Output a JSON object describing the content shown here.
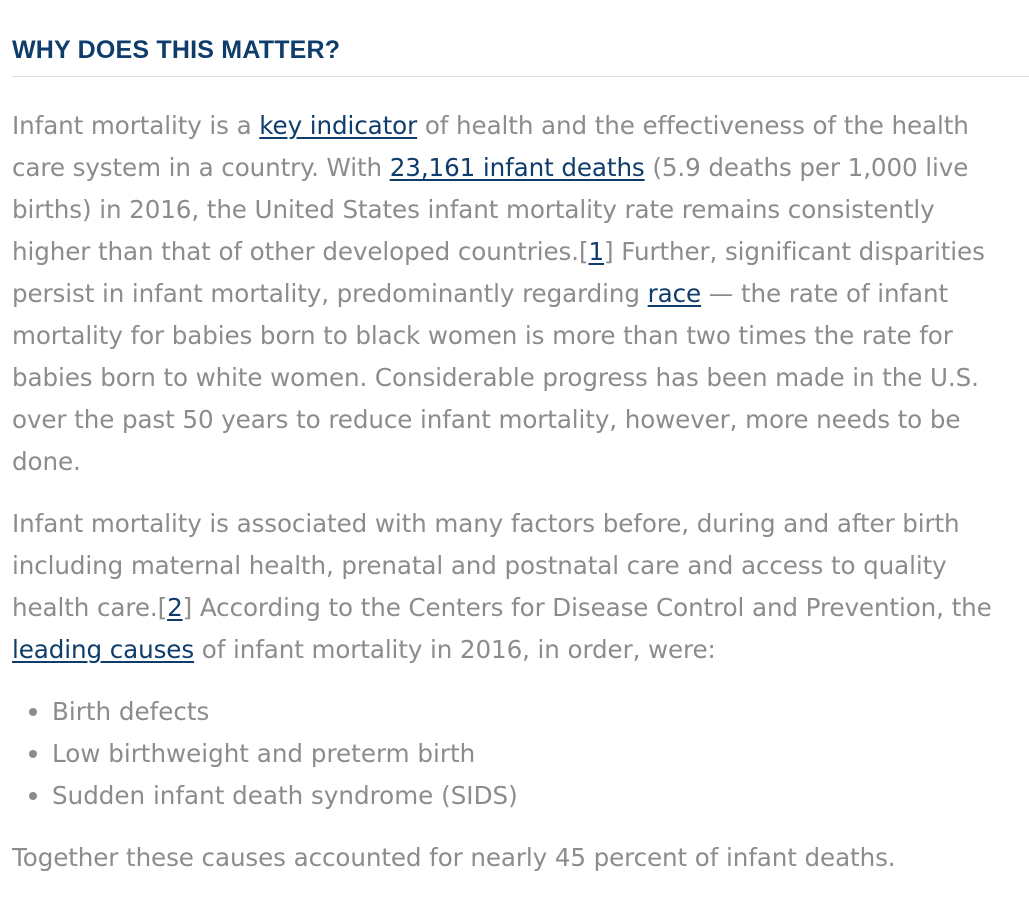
{
  "heading": "WHY DOES THIS MATTER?",
  "p1": {
    "t1": "Infant mortality is a ",
    "link1": "key indicator",
    "t2": " of health and the effectiveness of the health care system in a country. With ",
    "link2": "23,161 infant deaths",
    "t3": " (5.9 deaths per 1,000 live births) in 2016, the United States infant mortality rate remains consistently higher than that of other developed countries.[",
    "ref1": "1",
    "t4": "] Further, significant disparities persist in infant mortality, predominantly regarding ",
    "link3": "race",
    "t5": " — the rate of infant mortality for babies born to black women is more than two times the rate for babies born to white women. Considerable progress has been made in the U.S. over the past 50 years to reduce infant mortality, however, more needs to be done."
  },
  "p2": {
    "t1": "Infant mortality is associated with many factors before, during and after birth including maternal health, prenatal and postnatal care and access to quality health care.[",
    "ref2": "2",
    "t2": "] According to the Centers for Disease Control and Prevention, the ",
    "link4": "leading causes",
    "t3": " of infant mortality in 2016, in order, were:"
  },
  "causes": [
    "Birth defects",
    "Low birthweight and preterm birth",
    "Sudden infant death syndrome (SIDS)"
  ],
  "conclusion": "Together these causes accounted for nearly 45 percent of infant deaths.",
  "colors": {
    "heading": "#0e3d6b",
    "link": "#0e3d6b",
    "body_text": "#8c8c8c",
    "divider": "#dedede"
  }
}
